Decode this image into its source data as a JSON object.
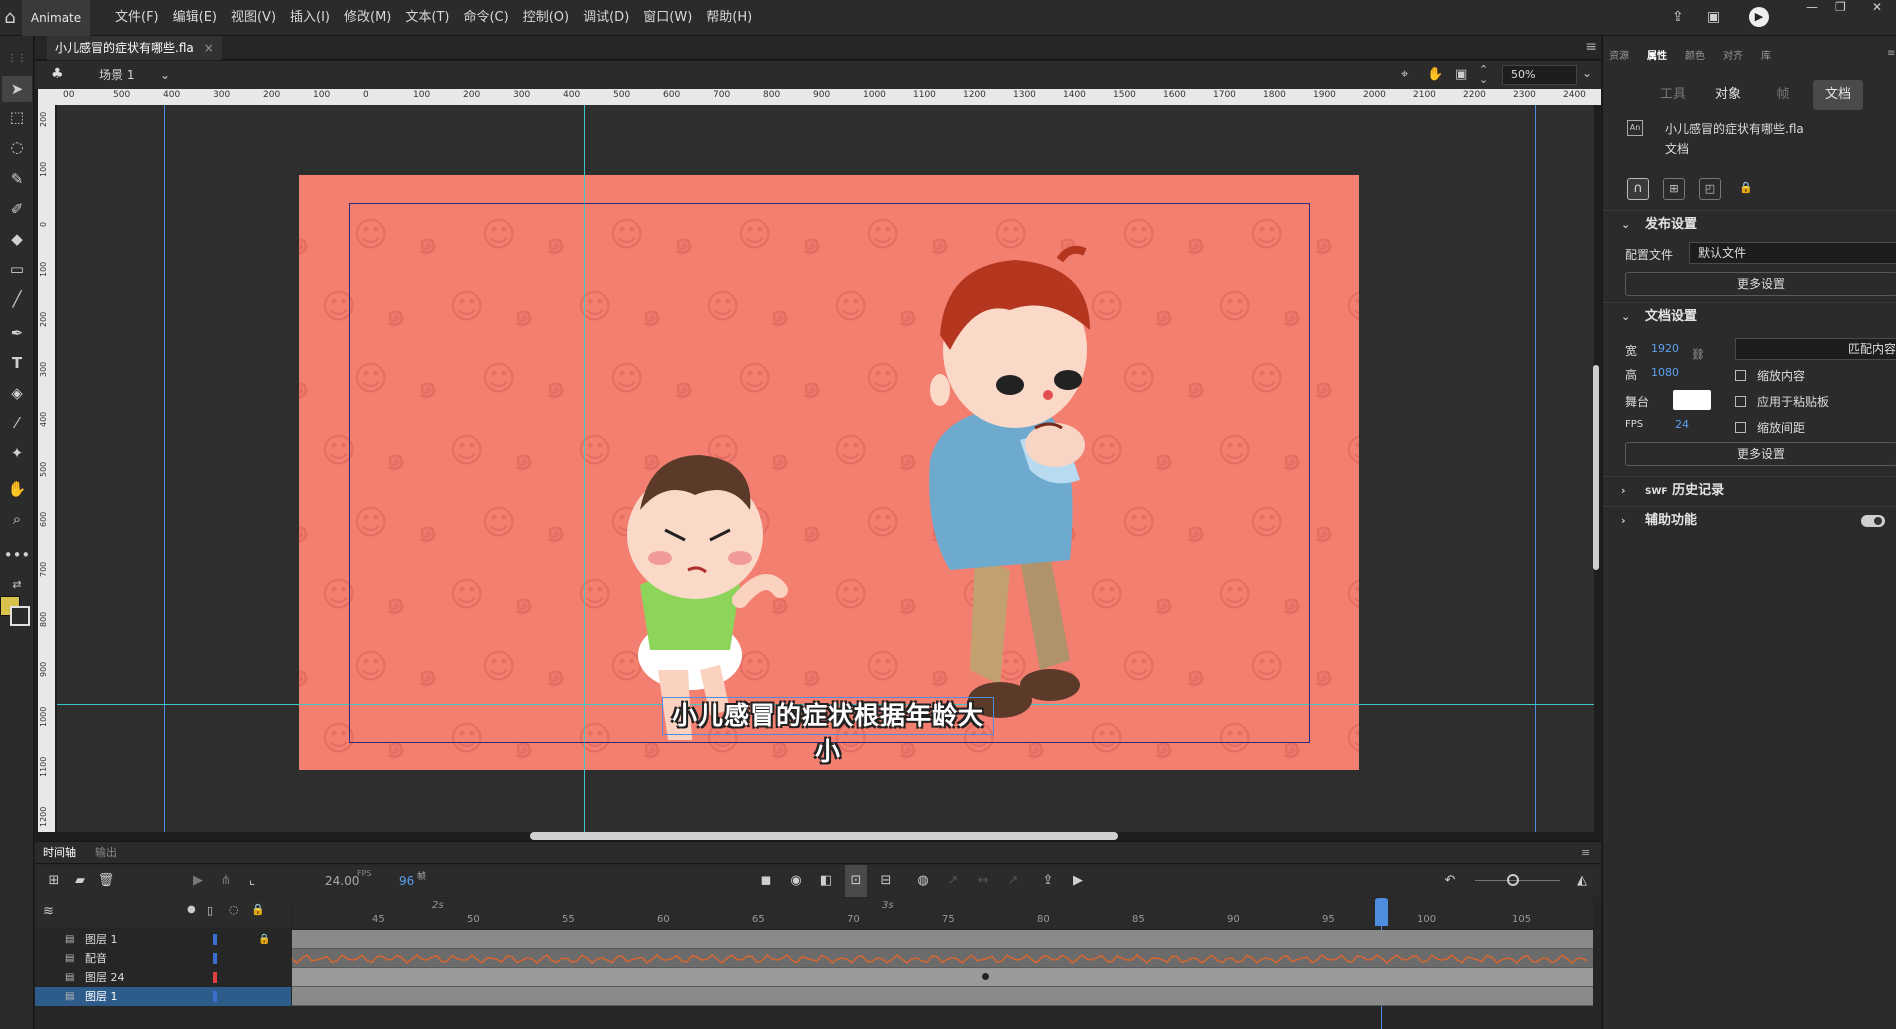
{
  "app": {
    "name": "Animate",
    "home_icon": "home-icon"
  },
  "menu": [
    "文件(F)",
    "编辑(E)",
    "视图(V)",
    "插入(I)",
    "修改(M)",
    "文本(T)",
    "命令(C)",
    "控制(O)",
    "调试(D)",
    "窗口(W)",
    "帮助(H)"
  ],
  "window_controls": {
    "minimize": "—",
    "restore": "❐",
    "close": "✕"
  },
  "document": {
    "tab_title": "小儿感冒的症状有哪些.fla",
    "close": "×"
  },
  "scene": {
    "name": "场景 1",
    "zoom": "50%"
  },
  "ruler": {
    "h_ticks": [
      "00",
      "500",
      "400",
      "300",
      "200",
      "100",
      "0",
      "100",
      "200",
      "300",
      "400",
      "500",
      "600",
      "700",
      "800",
      "900",
      "1000",
      "1100",
      "1200",
      "1300",
      "1400",
      "1500",
      "1600",
      "1700",
      "1800",
      "1900",
      "2000",
      "2100",
      "2200",
      "2300",
      "2400"
    ],
    "v_ticks": [
      "200",
      "100",
      "0",
      "100",
      "200",
      "300",
      "400",
      "500",
      "600",
      "700",
      "800",
      "900",
      "1000",
      "1100",
      "1200"
    ]
  },
  "stage": {
    "caption": "小儿感冒的症状根据年龄大小",
    "background": "#f37f70"
  },
  "timeline": {
    "tabs": {
      "timeline": "时间轴",
      "output": "输出"
    },
    "fps_value": "24.00",
    "fps_unit": "FPS",
    "frame_value": "96",
    "frame_unit": "帧",
    "time_marks": [
      "2s",
      "3s"
    ],
    "frame_numbers": [
      "45",
      "50",
      "55",
      "60",
      "65",
      "70",
      "75",
      "80",
      "85",
      "90",
      "95",
      "100",
      "105"
    ],
    "layers": [
      {
        "name": "图层 1",
        "color": "#3a6fd0",
        "locked": true,
        "selected": false
      },
      {
        "name": "配音",
        "color": "#3a6fd0",
        "locked": false,
        "selected": false
      },
      {
        "name": "图层 24",
        "color": "#e04040",
        "locked": false,
        "selected": false
      },
      {
        "name": "图层 1",
        "color": "#3a6fd0",
        "locked": false,
        "selected": true
      }
    ]
  },
  "panel": {
    "tabs": [
      "资源",
      "属性",
      "颜色",
      "对齐",
      "库"
    ],
    "segments": [
      "工具",
      "对象",
      "帧",
      "文档"
    ],
    "doc_name": "小儿感冒的症状有哪些.fla",
    "doc_type": "文档",
    "publish": {
      "title": "发布设置",
      "profile_label": "配置文件",
      "profile_value": "默认文件",
      "more": "更多设置"
    },
    "docsettings": {
      "title": "文档设置",
      "width_label": "宽",
      "width": "1920",
      "height_label": "高",
      "height": "1080",
      "match": "匹配内容",
      "scale": "缩放内容",
      "stage_label": "舞台",
      "paste": "应用于粘贴板",
      "fps_label": "FPS",
      "fps": "24",
      "spacing": "缩放间距",
      "more": "更多设置"
    },
    "swf": {
      "prefix": "SWF",
      "title": "历史记录"
    },
    "accessibility": "辅助功能"
  }
}
